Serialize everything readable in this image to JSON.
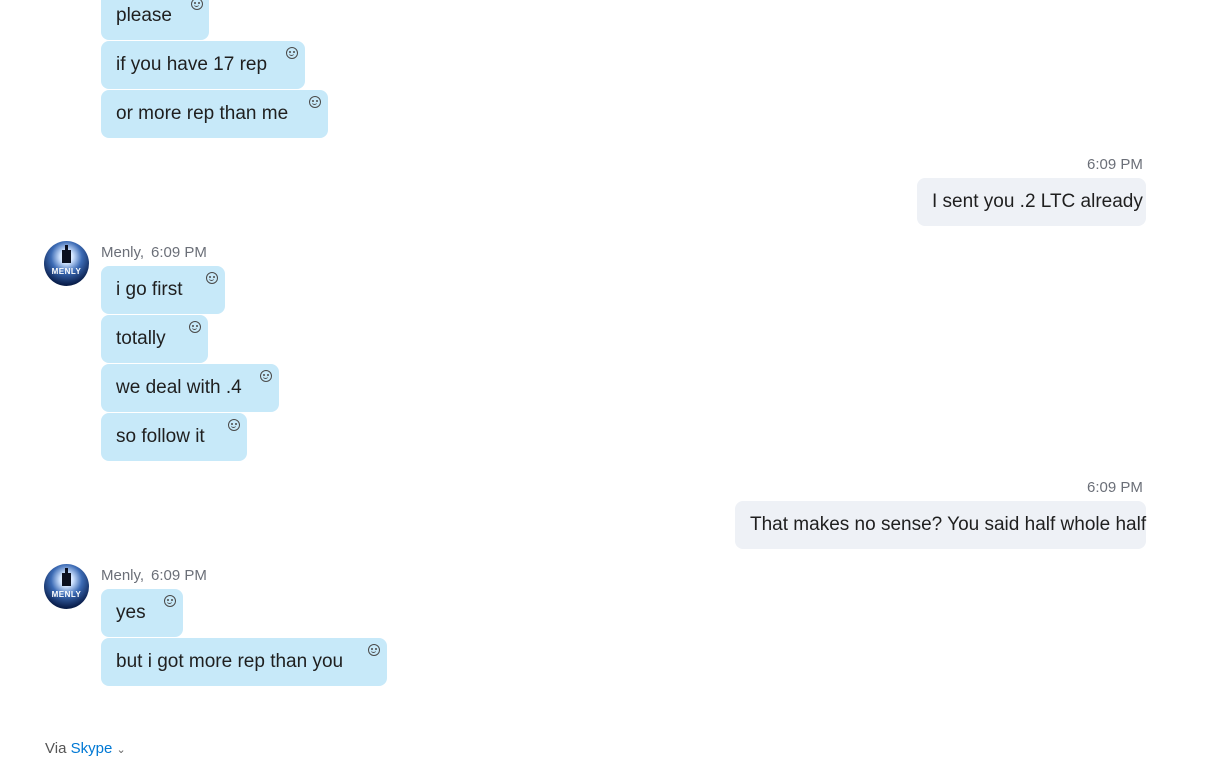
{
  "messages": {
    "m1": "please",
    "m2": "if you have 17 rep",
    "m3": "or more rep than me",
    "m4": "I sent you .2 LTC already",
    "m5": "i go first",
    "m6": "totally",
    "m7": "we deal with .4",
    "m8": "so follow it",
    "m9": "That makes no sense? You said half whole half",
    "m10": "yes",
    "m11": "but i got more rep than you"
  },
  "meta": {
    "sent_time_1": "6:09 PM",
    "sent_time_2": "6:09 PM",
    "sender_1": "Menly,",
    "time_1": "6:09 PM",
    "sender_2": "Menly,",
    "time_2": "6:09 PM"
  },
  "avatar": {
    "label": "MENLY"
  },
  "footer": {
    "via": "Via",
    "link": "Skype",
    "chevron": "⌄"
  },
  "icons": {
    "reaction": "smiley-icon",
    "avatar": "castle-moon-avatar"
  },
  "colors": {
    "incoming_bubble": "#c7e9f9",
    "outgoing_bubble": "#eef1f6",
    "link": "#0078d4"
  }
}
